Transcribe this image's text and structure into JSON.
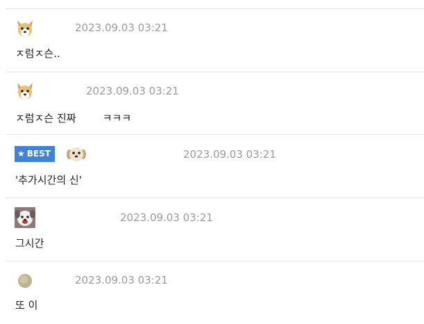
{
  "comments": [
    {
      "date": "2023.09.03 03:21",
      "text": "ㅈ럼ㅈ슨.."
    },
    {
      "date": "2023.09.03 03:21",
      "text": "ㅈ럼ㅈ슨 진짜        ㅋㅋㅋ"
    },
    {
      "date": "2023.09.03 03:21",
      "text": "'추가시간의 신'",
      "badge": "BEST",
      "badge_icon": "★"
    },
    {
      "date": "2023.09.03 03:21",
      "text": "그시간"
    },
    {
      "date": "2023.09.03 03:21",
      "text": "또 이"
    }
  ],
  "colors": {
    "badge_bg": "#3d83d9",
    "date": "#9a9a9a",
    "divider": "#e5e5e5"
  },
  "icons": {
    "comment_1_avatar": "dog-avatar-icon",
    "comment_2_avatar": "dog-avatar-icon",
    "comment_3_avatar": "puppy-avatar-icon",
    "comment_4_avatar": "bloody-dog-avatar-icon",
    "comment_5_avatar": "round-dot-avatar-icon",
    "badge_star": "star-icon"
  }
}
